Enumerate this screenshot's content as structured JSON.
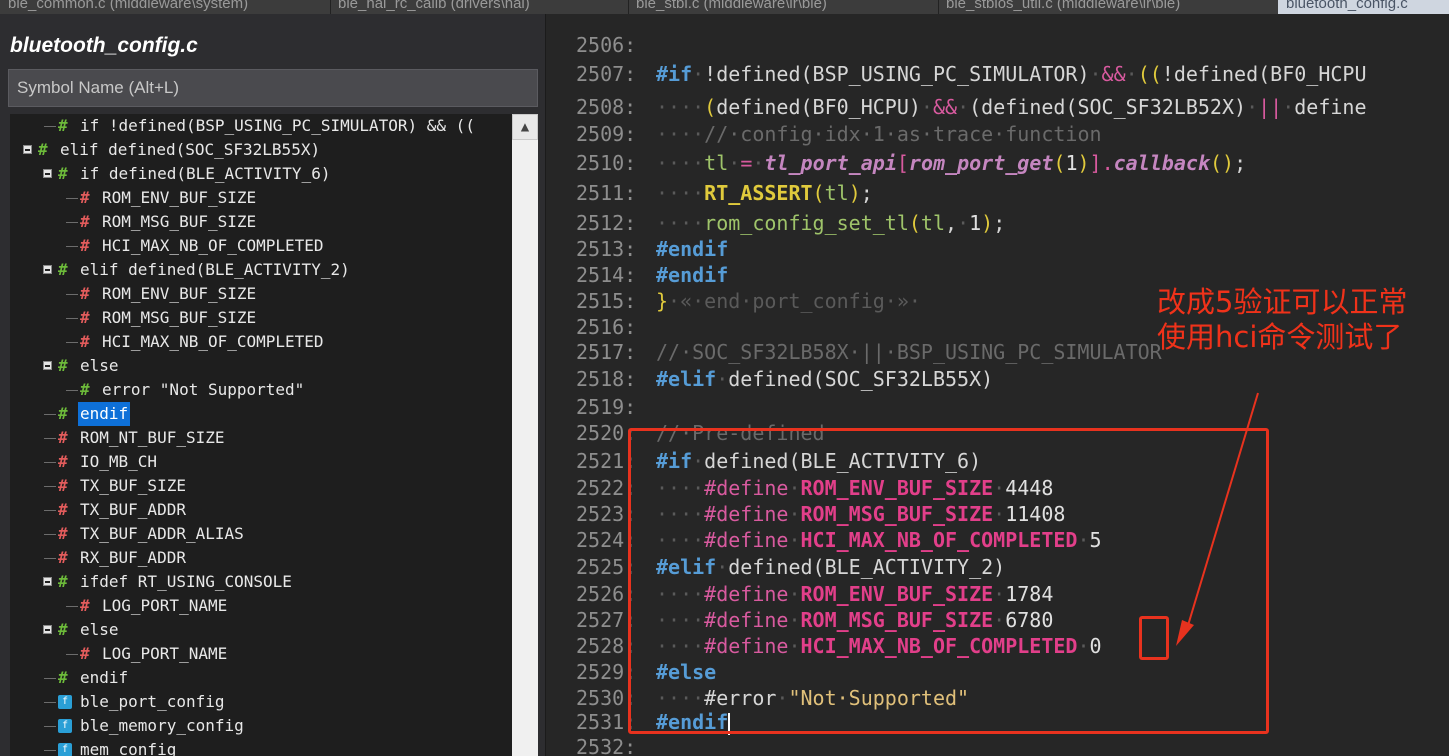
{
  "tabs": [
    "ble_common.c (middleware\\system)",
    "ble_hal_rc_calib (drivers\\hal)",
    "ble_stbi.c (middleware\\ir\\ble)",
    "ble_stbios_util.c (middleware\\ir\\ble)",
    "bluetooth_config.c"
  ],
  "panel": {
    "title": "bluetooth_config.c",
    "search_placeholder": "Symbol Name (Alt+L)"
  },
  "tree": [
    {
      "label": "if !defined(BSP_USING_PC_SIMULATOR) && ((",
      "icon": "green-hash",
      "indent": 1,
      "expander": false
    },
    {
      "label": "elif defined(SOC_SF32LB55X)",
      "icon": "green-hash",
      "indent": 0,
      "expander": true
    },
    {
      "label": "if defined(BLE_ACTIVITY_6)",
      "icon": "green-hash",
      "indent": 1,
      "expander": true
    },
    {
      "label": "ROM_ENV_BUF_SIZE",
      "icon": "red-hash",
      "indent": 2,
      "expander": false
    },
    {
      "label": "ROM_MSG_BUF_SIZE",
      "icon": "red-hash",
      "indent": 2,
      "expander": false
    },
    {
      "label": "HCI_MAX_NB_OF_COMPLETED",
      "icon": "red-hash",
      "indent": 2,
      "expander": false
    },
    {
      "label": "elif defined(BLE_ACTIVITY_2)",
      "icon": "green-hash",
      "indent": 1,
      "expander": true
    },
    {
      "label": "ROM_ENV_BUF_SIZE",
      "icon": "red-hash",
      "indent": 2,
      "expander": false
    },
    {
      "label": "ROM_MSG_BUF_SIZE",
      "icon": "red-hash",
      "indent": 2,
      "expander": false
    },
    {
      "label": "HCI_MAX_NB_OF_COMPLETED",
      "icon": "red-hash",
      "indent": 2,
      "expander": false
    },
    {
      "label": "else",
      "icon": "green-hash",
      "indent": 1,
      "expander": true
    },
    {
      "label": "error \"Not Supported\"",
      "icon": "green-hash",
      "indent": 2,
      "expander": false
    },
    {
      "label": "endif",
      "icon": "green-hash",
      "indent": 1,
      "expander": false,
      "selected": true
    },
    {
      "label": "ROM_NT_BUF_SIZE",
      "icon": "red-hash",
      "indent": 1,
      "expander": false
    },
    {
      "label": "IO_MB_CH",
      "icon": "red-hash",
      "indent": 1,
      "expander": false
    },
    {
      "label": "TX_BUF_SIZE",
      "icon": "red-hash",
      "indent": 1,
      "expander": false
    },
    {
      "label": "TX_BUF_ADDR",
      "icon": "red-hash",
      "indent": 1,
      "expander": false
    },
    {
      "label": "TX_BUF_ADDR_ALIAS",
      "icon": "red-hash",
      "indent": 1,
      "expander": false
    },
    {
      "label": "RX_BUF_ADDR",
      "icon": "red-hash",
      "indent": 1,
      "expander": false
    },
    {
      "label": "ifdef RT_USING_CONSOLE",
      "icon": "green-hash",
      "indent": 1,
      "expander": true
    },
    {
      "label": "LOG_PORT_NAME",
      "icon": "red-hash",
      "indent": 2,
      "expander": false
    },
    {
      "label": "else",
      "icon": "green-hash",
      "indent": 1,
      "expander": true
    },
    {
      "label": "LOG_PORT_NAME",
      "icon": "red-hash",
      "indent": 2,
      "expander": false
    },
    {
      "label": "endif",
      "icon": "green-hash",
      "indent": 1,
      "expander": false
    },
    {
      "label": "ble_port_config",
      "icon": "function",
      "indent": 1,
      "expander": false
    },
    {
      "label": "ble_memory_config",
      "icon": "function",
      "indent": 1,
      "expander": false
    },
    {
      "label": "mem_config",
      "icon": "function",
      "indent": 1,
      "expander": false
    }
  ],
  "code": [
    {
      "n": "2506:",
      "segs": []
    },
    {
      "n": "2507:",
      "segs": [
        [
          "pp",
          "#if"
        ],
        [
          "ws",
          "·"
        ],
        [
          "kw",
          "!defined("
        ],
        [
          "kw",
          "BSP_USING_PC_SIMULATOR)"
        ],
        [
          "ws",
          "·"
        ],
        [
          "mac2",
          "&&"
        ],
        [
          "ws",
          "·"
        ],
        [
          "paren",
          "(("
        ],
        [
          "kw",
          "!defined(BF0_HCPU"
        ]
      ]
    },
    {
      "n": "2508:",
      "segs": [
        [
          "ws",
          "····"
        ],
        [
          "paren",
          "("
        ],
        [
          "kw",
          "defined(BF0_HCPU)"
        ],
        [
          "ws",
          "·"
        ],
        [
          "mac2",
          "&&"
        ],
        [
          "ws",
          "·"
        ],
        [
          "kw",
          "(defined(SOC_SF32LB52X)"
        ],
        [
          "ws",
          "·"
        ],
        [
          "mac2",
          "||"
        ],
        [
          "ws",
          "·"
        ],
        [
          "kw",
          "define"
        ]
      ]
    },
    {
      "n": "2509:",
      "segs": [
        [
          "ws",
          "····"
        ],
        [
          "cm",
          "//·config·idx·1·as·trace·function"
        ]
      ]
    },
    {
      "n": "2510:",
      "segs": [
        [
          "ws",
          "····"
        ],
        [
          "call",
          "tl"
        ],
        [
          "ws",
          "·"
        ],
        [
          "mac2",
          "="
        ],
        [
          "ws",
          "·"
        ],
        [
          "fnp",
          "tl_port_api"
        ],
        [
          "mac2",
          "["
        ],
        [
          "fnp",
          "rom_port_get"
        ],
        [
          "paren",
          "("
        ],
        [
          "num",
          "1"
        ],
        [
          "paren",
          ")"
        ],
        [
          "mac2",
          "]"
        ],
        [
          "mac2",
          "."
        ],
        [
          "fnp",
          "callback"
        ],
        [
          "paren",
          "()"
        ],
        [
          "kw",
          ";"
        ]
      ]
    },
    {
      "n": "2511:",
      "segs": [
        [
          "ws",
          "····"
        ],
        [
          "fn",
          "RT_ASSERT"
        ],
        [
          "paren",
          "("
        ],
        [
          "call",
          "tl"
        ],
        [
          "paren",
          ")"
        ],
        [
          "kw",
          ";"
        ]
      ]
    },
    {
      "n": "2512:",
      "segs": [
        [
          "ws",
          "····"
        ],
        [
          "call",
          "rom_config_set_tl"
        ],
        [
          "paren",
          "("
        ],
        [
          "call",
          "tl"
        ],
        [
          "kw",
          ","
        ],
        [
          "ws",
          "·"
        ],
        [
          "num",
          "1"
        ],
        [
          "paren",
          ")"
        ],
        [
          "kw",
          ";"
        ]
      ]
    },
    {
      "n": "2513:",
      "segs": [
        [
          "pp",
          "#endif"
        ]
      ]
    },
    {
      "n": "2514:",
      "segs": [
        [
          "pp",
          "#endif"
        ]
      ]
    },
    {
      "n": "2515:",
      "segs": [
        [
          "paren",
          "}"
        ],
        [
          "ws",
          "·«·end·port_config·»·"
        ]
      ]
    },
    {
      "n": "2516:",
      "segs": []
    },
    {
      "n": "2517:",
      "segs": [
        [
          "cm",
          "//·SOC_SF32LB58X·||·BSP_USING_PC_SIMULATOR"
        ]
      ]
    },
    {
      "n": "2518:",
      "segs": [
        [
          "pp",
          "#elif"
        ],
        [
          "ws",
          "·"
        ],
        [
          "kw",
          "defined(SOC_SF32LB55X)"
        ]
      ]
    },
    {
      "n": "2519:",
      "segs": []
    },
    {
      "n": "2520:",
      "segs": [
        [
          "cm",
          "//·Pre-defined"
        ]
      ]
    },
    {
      "n": "2521:",
      "segs": [
        [
          "pp",
          "#if"
        ],
        [
          "ws",
          "·"
        ],
        [
          "kw",
          "defined(BLE_ACTIVITY_6)"
        ]
      ]
    },
    {
      "n": "2522:",
      "segs": [
        [
          "ws",
          "····"
        ],
        [
          "mac2",
          "#define"
        ],
        [
          "ws",
          "·"
        ],
        [
          "mac",
          "ROM_ENV_BUF_SIZE"
        ],
        [
          "ws",
          "·"
        ],
        [
          "num",
          "4448"
        ]
      ]
    },
    {
      "n": "2523:",
      "segs": [
        [
          "ws",
          "····"
        ],
        [
          "mac2",
          "#define"
        ],
        [
          "ws",
          "·"
        ],
        [
          "mac",
          "ROM_MSG_BUF_SIZE"
        ],
        [
          "ws",
          "·"
        ],
        [
          "num",
          "11408"
        ]
      ]
    },
    {
      "n": "2524:",
      "segs": [
        [
          "ws",
          "····"
        ],
        [
          "mac2",
          "#define"
        ],
        [
          "ws",
          "·"
        ],
        [
          "mac",
          "HCI_MAX_NB_OF_COMPLETED"
        ],
        [
          "ws",
          "·"
        ],
        [
          "num",
          "5"
        ]
      ]
    },
    {
      "n": "2525:",
      "segs": [
        [
          "pp",
          "#elif"
        ],
        [
          "ws",
          "·"
        ],
        [
          "kw",
          "defined(BLE_ACTIVITY_2)"
        ]
      ]
    },
    {
      "n": "2526:",
      "segs": [
        [
          "ws",
          "····"
        ],
        [
          "mac2",
          "#define"
        ],
        [
          "ws",
          "·"
        ],
        [
          "mac",
          "ROM_ENV_BUF_SIZE"
        ],
        [
          "ws",
          "·"
        ],
        [
          "num",
          "1784"
        ]
      ]
    },
    {
      "n": "2527:",
      "segs": [
        [
          "ws",
          "····"
        ],
        [
          "mac2",
          "#define"
        ],
        [
          "ws",
          "·"
        ],
        [
          "mac",
          "ROM_MSG_BUF_SIZE"
        ],
        [
          "ws",
          "·"
        ],
        [
          "num",
          "6780"
        ]
      ]
    },
    {
      "n": "2528:",
      "segs": [
        [
          "ws",
          "····"
        ],
        [
          "mac2",
          "#define"
        ],
        [
          "ws",
          "·"
        ],
        [
          "mac",
          "HCI_MAX_NB_OF_COMPLETED"
        ],
        [
          "ws",
          "·"
        ],
        [
          "num",
          "0"
        ]
      ]
    },
    {
      "n": "2529:",
      "segs": [
        [
          "pp",
          "#else"
        ]
      ]
    },
    {
      "n": "2530:",
      "segs": [
        [
          "ws",
          "····"
        ],
        [
          "kw",
          "#error"
        ],
        [
          "ws",
          "·"
        ],
        [
          "str",
          "\"Not·Supported\""
        ]
      ]
    },
    {
      "n": "2531:",
      "segs": [
        [
          "pp",
          "#endif"
        ],
        [
          "cursor",
          ""
        ]
      ]
    },
    {
      "n": "2532:",
      "segs": []
    }
  ],
  "annotation": {
    "note": "改成5验证可以正常使用hci命令测试了",
    "color": "#e8321e"
  }
}
